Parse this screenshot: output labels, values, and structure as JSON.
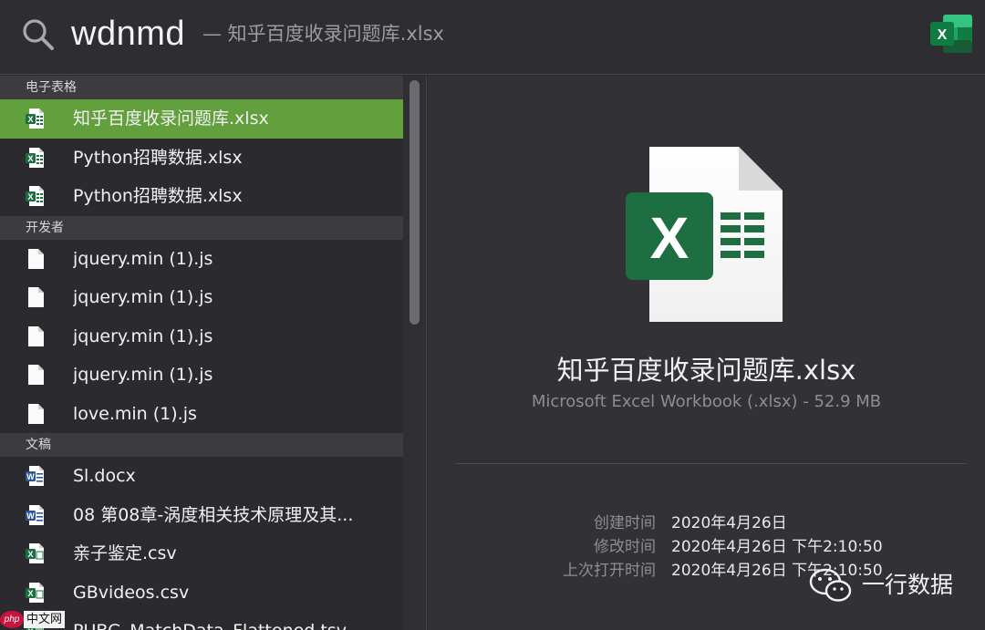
{
  "search": {
    "query": "wdnmd",
    "hint": "— 知乎百度收录问题库.xlsx",
    "icon": "search-icon",
    "app_icon": "excel-app-icon"
  },
  "results": {
    "sections": [
      {
        "title": "电子表格",
        "items": [
          {
            "label": "知乎百度收录问题库.xlsx",
            "icon": "excel-file-icon",
            "selected": true
          },
          {
            "label": "Python招聘数据.xlsx",
            "icon": "excel-file-icon",
            "selected": false
          },
          {
            "label": "Python招聘数据.xlsx",
            "icon": "excel-file-icon",
            "selected": false
          }
        ]
      },
      {
        "title": "开发者",
        "items": [
          {
            "label": "jquery.min (1).js",
            "icon": "blank-file-icon",
            "selected": false
          },
          {
            "label": "jquery.min (1).js",
            "icon": "blank-file-icon",
            "selected": false
          },
          {
            "label": "jquery.min (1).js",
            "icon": "blank-file-icon",
            "selected": false
          },
          {
            "label": "jquery.min (1).js",
            "icon": "blank-file-icon",
            "selected": false
          },
          {
            "label": "love.min (1).js",
            "icon": "blank-file-icon",
            "selected": false
          }
        ]
      },
      {
        "title": "文稿",
        "items": [
          {
            "label": "Sl.docx",
            "icon": "word-file-icon",
            "selected": false
          },
          {
            "label": "08 第08章-涡度相关技术原理及其...",
            "icon": "word-file-icon",
            "selected": false
          },
          {
            "label": "亲子鉴定.csv",
            "icon": "csv-file-icon",
            "selected": false
          },
          {
            "label": "GBvideos.csv",
            "icon": "csv-file-icon",
            "selected": false
          },
          {
            "label": "PUBG_MatchData_Flattened.tsv",
            "icon": "csv-file-icon",
            "selected": false
          }
        ]
      }
    ]
  },
  "preview": {
    "title": "知乎百度收录问题库.xlsx",
    "subtitle": "Microsoft Excel Workbook (.xlsx) - 52.9 MB",
    "meta": [
      {
        "key": "创建时间",
        "value": "2020年4月26日"
      },
      {
        "key": "修改时间",
        "value": "2020年4月26日 下午2:10:50"
      },
      {
        "key": "上次打开时间",
        "value": "2020年4月26日 下午2:10:50"
      }
    ]
  },
  "watermark": {
    "text": "一行数据",
    "php_badge": "php",
    "php_text": "中文网"
  },
  "colors": {
    "selected": "#62a03d",
    "excel_green": "#1d6f42",
    "word_blue": "#2b579a"
  }
}
